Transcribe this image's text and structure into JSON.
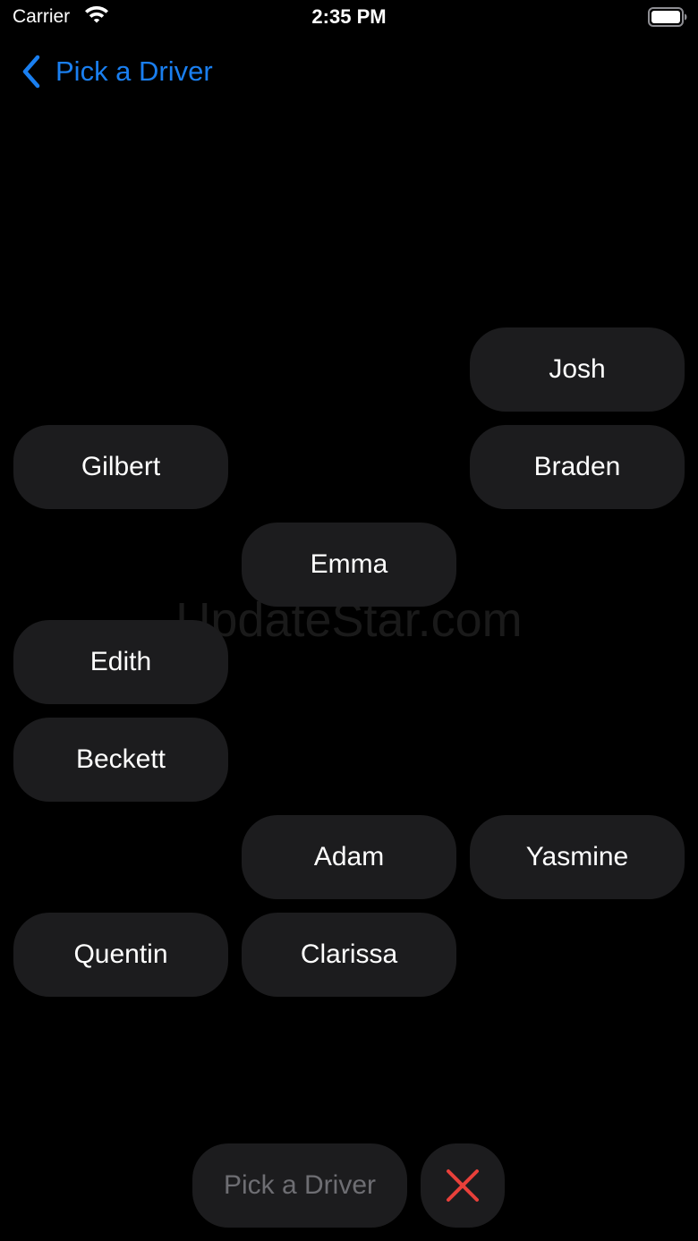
{
  "status_bar": {
    "carrier": "Carrier",
    "time": "2:35 PM",
    "icons": [
      "wifi-icon",
      "battery-icon"
    ]
  },
  "nav": {
    "back_label": "Pick a Driver",
    "back_icon": "chevron-left-icon",
    "accent_color": "#1a7ff0"
  },
  "drivers": {
    "josh": "Josh",
    "gilbert": "Gilbert",
    "braden": "Braden",
    "emma": "Emma",
    "edith": "Edith",
    "beckett": "Beckett",
    "adam": "Adam",
    "yasmine": "Yasmine",
    "quentin": "Quentin",
    "clarissa": "Clarissa"
  },
  "watermark": "UpdateStar.com",
  "footer": {
    "pick_label": "Pick a Driver",
    "pick_enabled": false,
    "close_icon": "close-icon",
    "close_color": "#e8403a"
  }
}
